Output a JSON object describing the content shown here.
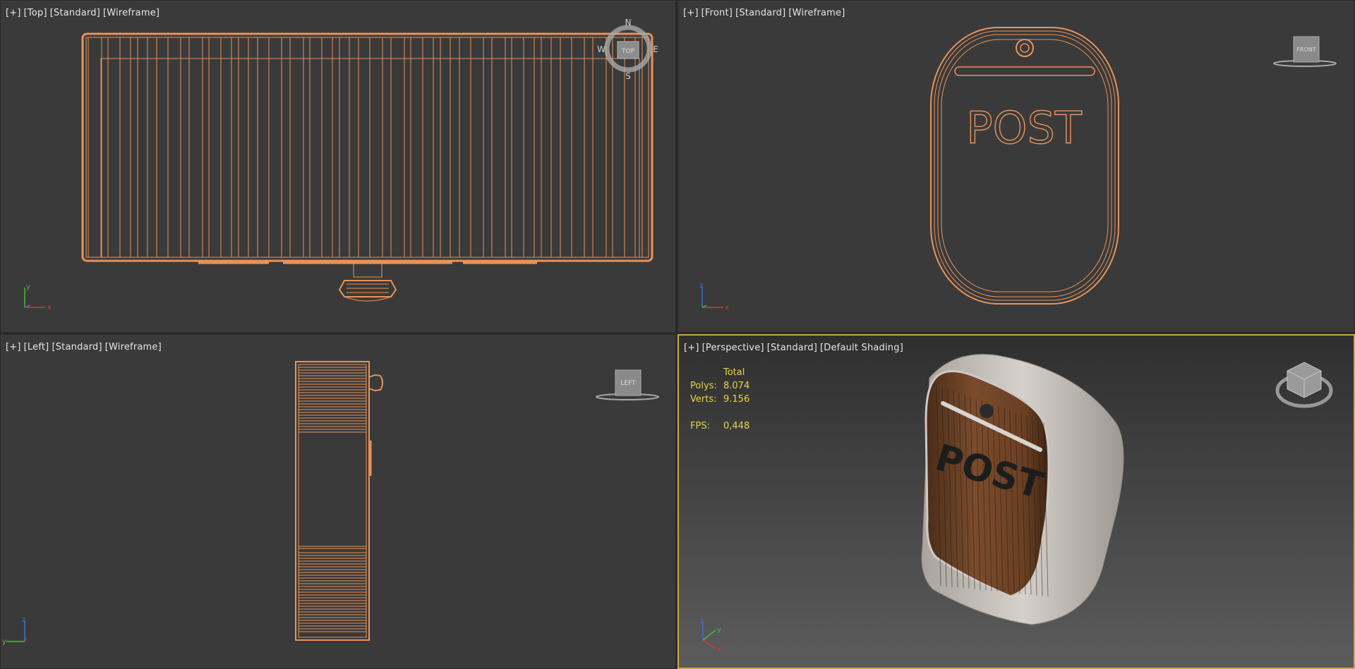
{
  "viewports": [
    {
      "id": "top",
      "labels": [
        "[+]",
        "[Top]",
        "[Standard]",
        "[Wireframe]"
      ],
      "compass": {
        "n": "N",
        "s": "S",
        "e": "E",
        "w": "W"
      },
      "viewcube_text": "TOP",
      "axes": {
        "a": "y",
        "b": "x"
      }
    },
    {
      "id": "front",
      "labels": [
        "[+]",
        "[Front]",
        "[Standard]",
        "[Wireframe]"
      ],
      "viewcube_text": "FRONT",
      "model_text": "POST",
      "axes": {
        "a": "z",
        "b": "x"
      }
    },
    {
      "id": "left",
      "labels": [
        "[+]",
        "[Left]",
        "[Standard]",
        "[Wireframe]"
      ],
      "viewcube_text": "LEFT",
      "axes": {
        "a": "z",
        "b": "y"
      }
    },
    {
      "id": "perspective",
      "labels": [
        "[+]",
        "[Perspective]",
        "[Standard]",
        "[Default Shading]"
      ],
      "stats": {
        "total_label": "Total",
        "polys_label": "Polys:",
        "polys_value": "8.074",
        "verts_label": "Verts:",
        "verts_value": "9.156",
        "fps_label": "FPS:",
        "fps_value": "0,448"
      },
      "model_text": "POST",
      "axes": {
        "a": "z",
        "b": "y",
        "c": "x"
      }
    }
  ],
  "colors": {
    "wire": "#e8935a",
    "viewport_bg": "#3a3a3a",
    "active_border": "#c9aa4a",
    "stats_text": "#e8d44a"
  }
}
